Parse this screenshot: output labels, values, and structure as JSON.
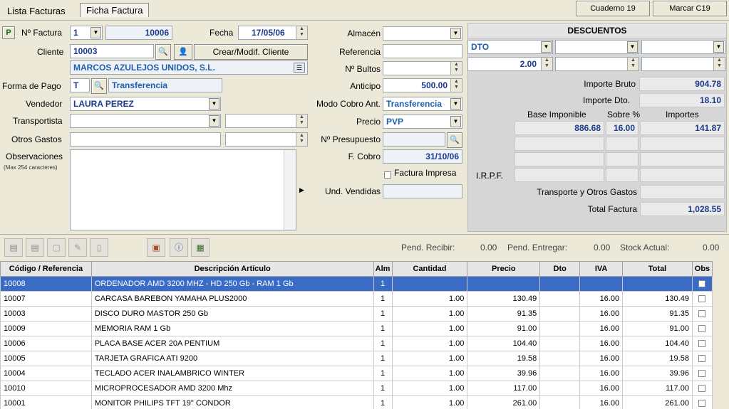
{
  "tabs": [
    "Lista Facturas",
    "Ficha Factura"
  ],
  "top_buttons": [
    "Cuaderno 19",
    "Marcar C19"
  ],
  "form": {
    "p_button": "P",
    "num_factura_label": "Nº Factura",
    "num_factura_serie": "1",
    "num_factura_value": "10006",
    "fecha_label": "Fecha",
    "fecha_value": "17/05/06",
    "cliente_label": "Cliente",
    "cliente_code": "10003",
    "crear_cliente_button": "Crear/Modif. Cliente",
    "cliente_name": "MARCOS AZULEJOS UNIDOS, S.L.",
    "forma_pago_label": "Forma de Pago",
    "forma_pago_code": "T",
    "forma_pago_value": "Transferencia",
    "vendedor_label": "Vendedor",
    "vendedor_value": "LAURA PEREZ",
    "transportista_label": "Transportista",
    "otros_gastos_label": "Otros Gastos",
    "observaciones_label": "Observaciones",
    "observaciones_note": "(Max 254 caracteres)",
    "almacen_label": "Almacén",
    "referencia_label": "Referencia",
    "bultos_label": "Nº Bultos",
    "anticipo_label": "Anticipo",
    "anticipo_value": "500.00",
    "modo_cobro_label": "Modo Cobro Ant.",
    "modo_cobro_value": "Transferencia",
    "precio_label": "Precio",
    "precio_value": "PVP",
    "presupuesto_label": "Nº Presupuesto",
    "f_cobro_label": "F. Cobro",
    "f_cobro_value": "31/10/06",
    "factura_impresa_label": "Factura Impresa",
    "und_vendidas_label": "Und. Vendidas"
  },
  "descuentos": {
    "title": "DESCUENTOS",
    "dto_select": "DTO",
    "dto_value": "2.00",
    "importe_bruto_label": "Importe Bruto",
    "importe_bruto_value": "904.78",
    "importe_dto_label": "Importe Dto.",
    "importe_dto_value": "18.10",
    "base_imponible_label": "Base Imponible",
    "sobre_label": "Sobre %",
    "importes_label": "Importes",
    "base_value": "886.68",
    "sobre_value": "16.00",
    "importes_value": "141.87",
    "irpf_label": "I.R.P.F.",
    "transporte_label": "Transporte y Otros Gastos",
    "total_label": "Total Factura",
    "total_value": "1,028.55"
  },
  "stock": {
    "pend_recibir_label": "Pend. Recibir:",
    "pend_recibir_value": "0.00",
    "pend_entregar_label": "Pend. Entregar:",
    "pend_entregar_value": "0.00",
    "stock_actual_label": "Stock Actual:",
    "stock_actual_value": "0.00"
  },
  "grid": {
    "columns": [
      "Código / Referencia",
      "Descripción Artículo",
      "Alm",
      "Cantidad",
      "Precio",
      "Dto",
      "IVA",
      "Total",
      "Obs"
    ],
    "rows": [
      {
        "codigo": "10008",
        "descripcion": "ORDENADOR AMD 3200 MHZ - HD 250 Gb - RAM 1 Gb",
        "alm": "1",
        "cantidad": "",
        "precio": "",
        "dto": "",
        "iva": "",
        "total": ""
      },
      {
        "codigo": "10007",
        "descripcion": "CARCASA BAREBON YAMAHA PLUS2000",
        "alm": "1",
        "cantidad": "1.00",
        "precio": "130.49",
        "dto": "",
        "iva": "16.00",
        "total": "130.49"
      },
      {
        "codigo": "10003",
        "descripcion": "DISCO DURO MASTOR 250 Gb",
        "alm": "1",
        "cantidad": "1.00",
        "precio": "91.35",
        "dto": "",
        "iva": "16.00",
        "total": "91.35"
      },
      {
        "codigo": "10009",
        "descripcion": "MEMORIA RAM 1 Gb",
        "alm": "1",
        "cantidad": "1.00",
        "precio": "91.00",
        "dto": "",
        "iva": "16.00",
        "total": "91.00"
      },
      {
        "codigo": "10006",
        "descripcion": "PLACA BASE ACER 20A PENTIUM",
        "alm": "1",
        "cantidad": "1.00",
        "precio": "104.40",
        "dto": "",
        "iva": "16.00",
        "total": "104.40"
      },
      {
        "codigo": "10005",
        "descripcion": "TARJETA GRAFICA ATI 9200",
        "alm": "1",
        "cantidad": "1.00",
        "precio": "19.58",
        "dto": "",
        "iva": "16.00",
        "total": "19.58"
      },
      {
        "codigo": "10004",
        "descripcion": "TECLADO ACER INALAMBRICO WINTER",
        "alm": "1",
        "cantidad": "1.00",
        "precio": "39.96",
        "dto": "",
        "iva": "16.00",
        "total": "39.96"
      },
      {
        "codigo": "10010",
        "descripcion": "MICROPROCESADOR AMD 3200 Mhz",
        "alm": "1",
        "cantidad": "1.00",
        "precio": "117.00",
        "dto": "",
        "iva": "16.00",
        "total": "117.00"
      },
      {
        "codigo": "10001",
        "descripcion": "MONITOR PHILIPS TFT 19\" CONDOR",
        "alm": "1",
        "cantidad": "1.00",
        "precio": "261.00",
        "dto": "",
        "iva": "16.00",
        "total": "261.00"
      }
    ]
  }
}
